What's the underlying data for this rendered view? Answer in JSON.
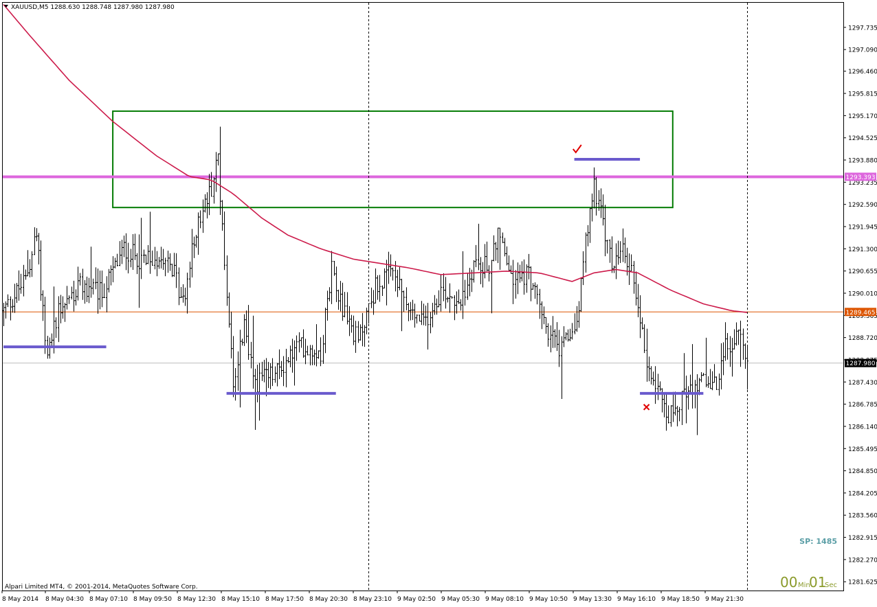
{
  "header": {
    "symbol_text": "XAUUSD,M5  1288.630 1288.748 1287.980 1287.980"
  },
  "footer": {
    "copyright": "Alpari Limited MT4, © 2001-2014, MetaQuotes Software Corp.",
    "spread": "SP: 1485",
    "timer": {
      "min_value": "00",
      "min_label": "Min",
      "sec_value": "01",
      "sec_label": "Sec"
    }
  },
  "colors": {
    "candles": "#000000",
    "moving_average": "#cc1a4a",
    "resistance_line": "#dd66dd",
    "resistance_label_bg": "#dd66dd",
    "bid_line": "#dd5500",
    "bid_label_bg": "#dd5500",
    "last_line": "#bbbbbb",
    "last_label_bg": "#000000",
    "zone_rectangle": "#007a00",
    "level_segments": "#6a5acd",
    "check_mark": "#e00000",
    "cross_mark": "#e00000",
    "spread_text": "#5b9ea6",
    "timer_text": "#8a9a2a"
  },
  "chart_data": {
    "type": "candlestick",
    "symbol": "XAUUSD",
    "timeframe": "M5",
    "ylim": [
      1281.37,
      1298.45
    ],
    "y_ticks": [
      "1297.735",
      "1297.090",
      "1296.460",
      "1295.815",
      "1295.170",
      "1294.525",
      "1293.880",
      "1293.235",
      "1292.590",
      "1291.945",
      "1291.300",
      "1290.655",
      "1290.010",
      "1289.365",
      "1288.720",
      "1288.075",
      "1287.430",
      "1286.785",
      "1286.140",
      "1285.495",
      "1284.850",
      "1284.205",
      "1283.560",
      "1282.915",
      "1282.270",
      "1281.625"
    ],
    "x_ticks": [
      "8 May 2014",
      "8 May 04:30",
      "8 May 07:10",
      "8 May 09:50",
      "8 May 12:30",
      "8 May 15:10",
      "8 May 17:50",
      "8 May 20:30",
      "8 May 23:10",
      "9 May 02:50",
      "9 May 05:30",
      "9 May 08:10",
      "9 May 10:50",
      "9 May 13:30",
      "9 May 16:10",
      "9 May 18:50",
      "9 May 21:30"
    ],
    "x_range_bars": [
      0,
      340
    ],
    "ohlc_keyframes": [
      [
        0,
        1289.5
      ],
      [
        10,
        1290.4
      ],
      [
        15,
        1291.7
      ],
      [
        20,
        1288.1
      ],
      [
        25,
        1289.6
      ],
      [
        35,
        1290.2
      ],
      [
        45,
        1290.0
      ],
      [
        55,
        1291.3
      ],
      [
        65,
        1290.9
      ],
      [
        75,
        1291.2
      ],
      [
        82,
        1289.7
      ],
      [
        88,
        1291.9
      ],
      [
        95,
        1293.1
      ],
      [
        98,
        1294.0
      ],
      [
        100,
        1291.8
      ],
      [
        105,
        1287.5
      ],
      [
        110,
        1289.0
      ],
      [
        115,
        1287.4
      ],
      [
        125,
        1287.7
      ],
      [
        135,
        1288.5
      ],
      [
        145,
        1288.3
      ],
      [
        150,
        1290.8
      ],
      [
        155,
        1289.6
      ],
      [
        162,
        1288.6
      ],
      [
        170,
        1290.2
      ],
      [
        178,
        1290.6
      ],
      [
        185,
        1289.5
      ],
      [
        192,
        1289.1
      ],
      [
        200,
        1290.1
      ],
      [
        210,
        1289.8
      ],
      [
        215,
        1290.9
      ],
      [
        222,
        1290.8
      ],
      [
        226,
        1291.8
      ],
      [
        232,
        1290.4
      ],
      [
        240,
        1290.6
      ],
      [
        248,
        1289.0
      ],
      [
        255,
        1288.3
      ],
      [
        262,
        1289.2
      ],
      [
        266,
        1291.4
      ],
      [
        270,
        1293.2
      ],
      [
        274,
        1292.0
      ],
      [
        278,
        1290.8
      ],
      [
        283,
        1291.2
      ],
      [
        288,
        1290.5
      ],
      [
        294,
        1288.0
      ],
      [
        300,
        1287.3
      ],
      [
        304,
        1286.4
      ],
      [
        310,
        1287.0
      ],
      [
        318,
        1287.5
      ],
      [
        326,
        1287.3
      ],
      [
        330,
        1288.4
      ],
      [
        336,
        1288.8
      ],
      [
        340,
        1288.0
      ]
    ],
    "moving_average_keyframes": [
      [
        0,
        1298.4
      ],
      [
        12,
        1297.5
      ],
      [
        30,
        1296.2
      ],
      [
        50,
        1295.0
      ],
      [
        70,
        1294.0
      ],
      [
        85,
        1293.4
      ],
      [
        95,
        1293.3
      ],
      [
        105,
        1292.9
      ],
      [
        118,
        1292.2
      ],
      [
        130,
        1291.7
      ],
      [
        145,
        1291.3
      ],
      [
        160,
        1291.0
      ],
      [
        170,
        1290.9
      ],
      [
        185,
        1290.75
      ],
      [
        200,
        1290.55
      ],
      [
        215,
        1290.6
      ],
      [
        230,
        1290.65
      ],
      [
        245,
        1290.6
      ],
      [
        260,
        1290.35
      ],
      [
        270,
        1290.6
      ],
      [
        280,
        1290.7
      ],
      [
        290,
        1290.6
      ],
      [
        305,
        1290.1
      ],
      [
        320,
        1289.7
      ],
      [
        333,
        1289.5
      ],
      [
        340,
        1289.45
      ]
    ],
    "horizontal_lines": [
      {
        "price": 1293.393,
        "label": "1293.393",
        "role": "resistance_line"
      },
      {
        "price": 1289.465,
        "label": "1289.465",
        "role": "bid_line"
      },
      {
        "price": 1287.98,
        "label": "1287.980",
        "role": "last_line"
      }
    ],
    "vertical_separators_bars": [
      167,
      340
    ],
    "rectangle_zone": {
      "bar_from": 50,
      "bar_to": 306,
      "price_top": 1295.3,
      "price_bottom": 1292.5
    },
    "level_segments": [
      {
        "bar_from": 0,
        "bar_to": 47,
        "price": 1288.45
      },
      {
        "bar_from": 102,
        "bar_to": 152,
        "price": 1287.1
      },
      {
        "bar_from": 261,
        "bar_to": 291,
        "price": 1293.9
      },
      {
        "bar_from": 291,
        "bar_to": 320,
        "price": 1287.1
      }
    ],
    "marks": [
      {
        "type": "check",
        "bar": 262,
        "price": 1294.2
      },
      {
        "type": "cross",
        "bar": 294,
        "price": 1286.7
      }
    ]
  }
}
